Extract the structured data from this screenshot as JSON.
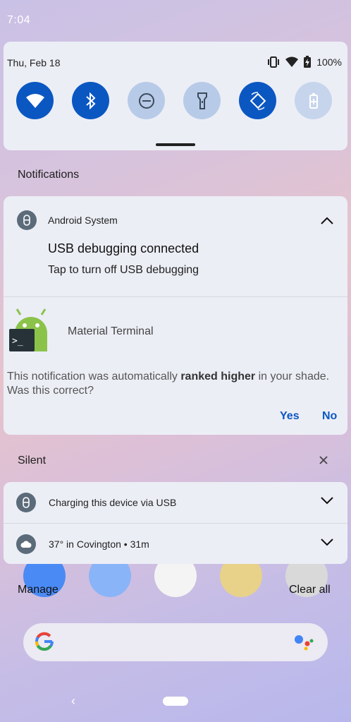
{
  "status_bar": {
    "time": "7:04"
  },
  "quick_settings": {
    "date": "Thu, Feb 18",
    "battery": "100%",
    "tiles": [
      {
        "name": "wifi",
        "state": "on"
      },
      {
        "name": "bluetooth",
        "state": "on"
      },
      {
        "name": "do-not-disturb",
        "state": "off"
      },
      {
        "name": "flashlight",
        "state": "off"
      },
      {
        "name": "auto-rotate",
        "state": "on"
      },
      {
        "name": "battery-saver",
        "state": "disabled"
      }
    ]
  },
  "notifications": {
    "section_title": "Notifications",
    "usb_card": {
      "app_name": "Android System",
      "title": "USB debugging connected",
      "text": "Tap to turn off USB debugging"
    },
    "terminal_card": {
      "app_name": "Material Terminal",
      "feedback_pre": "This notification was automatically ",
      "feedback_bold": "ranked higher",
      "feedback_post": " in your shade. Was this correct?",
      "yes_label": "Yes",
      "no_label": "No"
    }
  },
  "silent": {
    "section_title": "Silent",
    "items": [
      {
        "text": "Charging this device via USB"
      },
      {
        "text": "37° in Covington • 31m"
      }
    ]
  },
  "footer": {
    "manage_label": "Manage",
    "clear_all_label": "Clear all"
  },
  "colors": {
    "accent": "#0b57c2",
    "panel": "#eceef6"
  }
}
